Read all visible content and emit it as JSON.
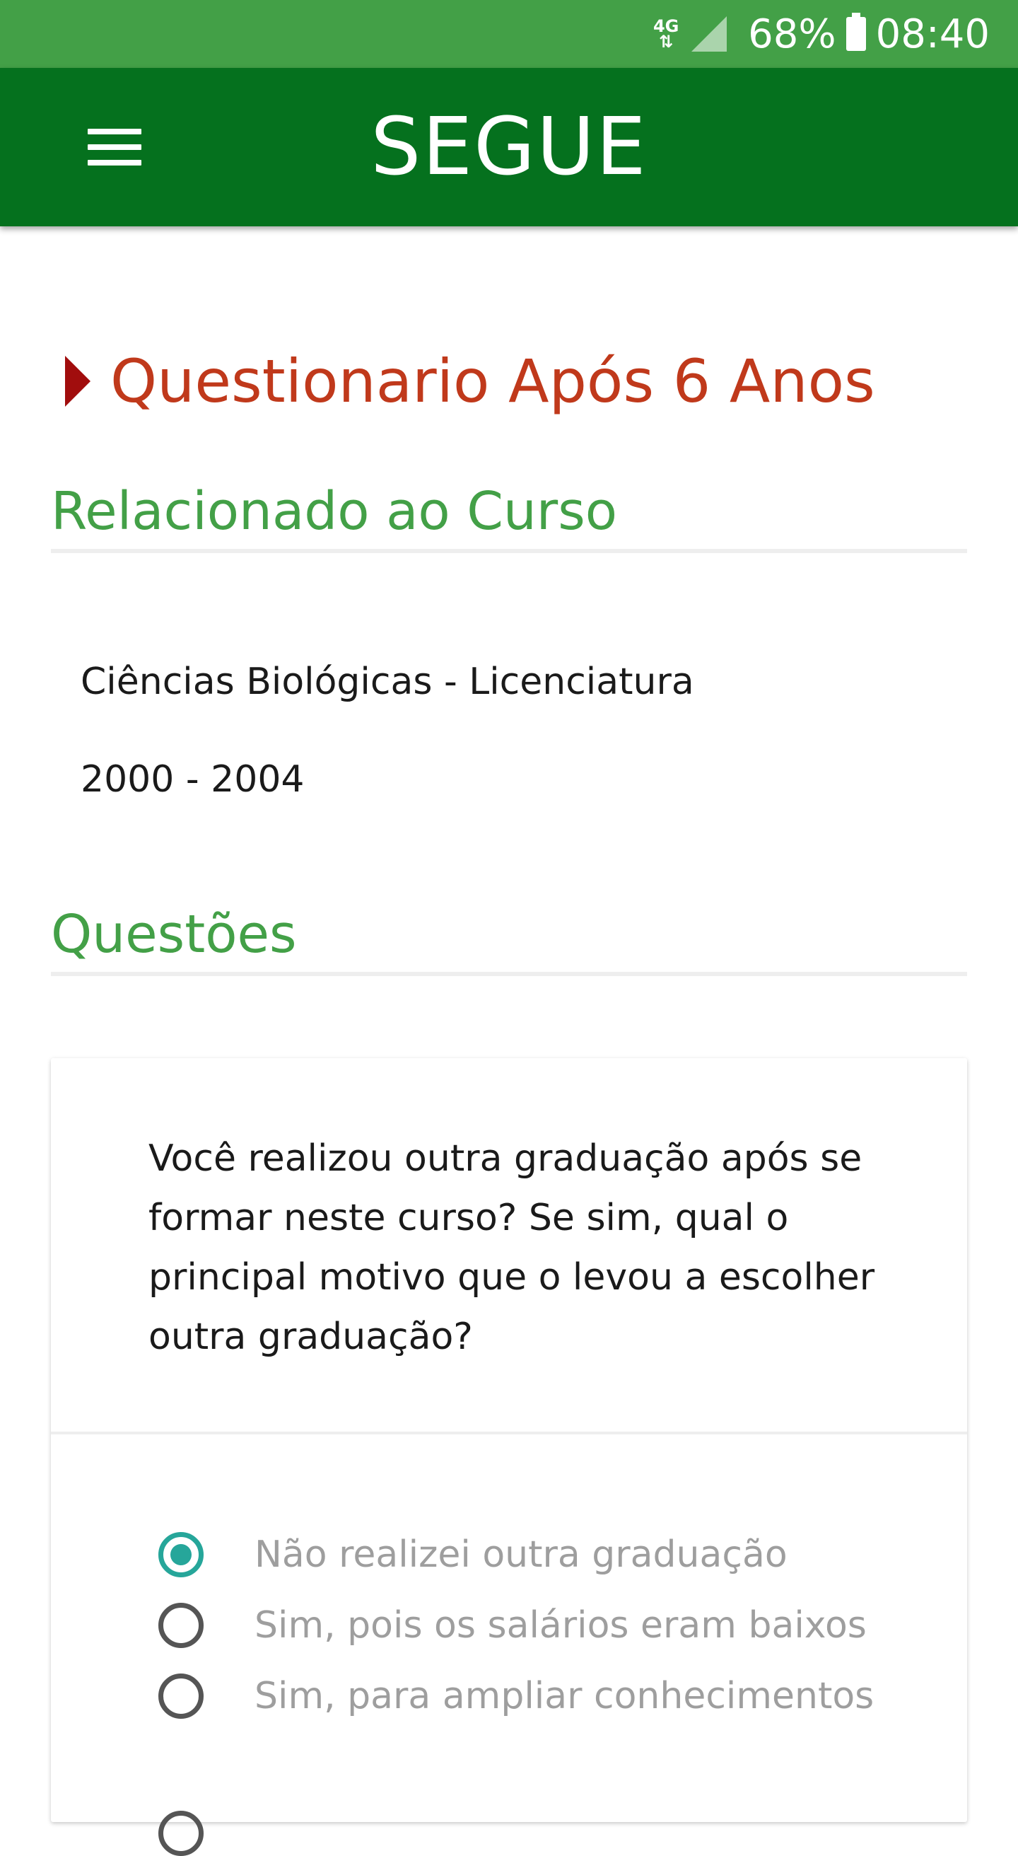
{
  "status_bar": {
    "network": "4G",
    "battery": "68%",
    "time": "08:40"
  },
  "app_bar": {
    "title": "SEGUE"
  },
  "page": {
    "title": "Questionario Após 6 Anos"
  },
  "course_section": {
    "header": "Relacionado ao Curso",
    "course_name": "Ciências Biológicas - Licenciatura",
    "years": "2000 - 2004"
  },
  "questions_section": {
    "header": "Questões"
  },
  "question": {
    "text": "Você realizou outra graduação após se formar neste curso? Se sim, qual o principal motivo que o levou a escolher outra graduação?",
    "options": [
      {
        "label": "Não realizei outra graduação",
        "selected": true
      },
      {
        "label": "Sim, pois os salários eram baixos",
        "selected": false
      },
      {
        "label": "Sim, para ampliar conhecimentos",
        "selected": false
      },
      {
        "label": "",
        "selected": false
      }
    ]
  },
  "colors": {
    "status_bar": "#43a047",
    "app_bar": "#05711e",
    "page_title": "#c0391b",
    "section_header": "#43a047",
    "radio_selected": "#26a69a"
  }
}
